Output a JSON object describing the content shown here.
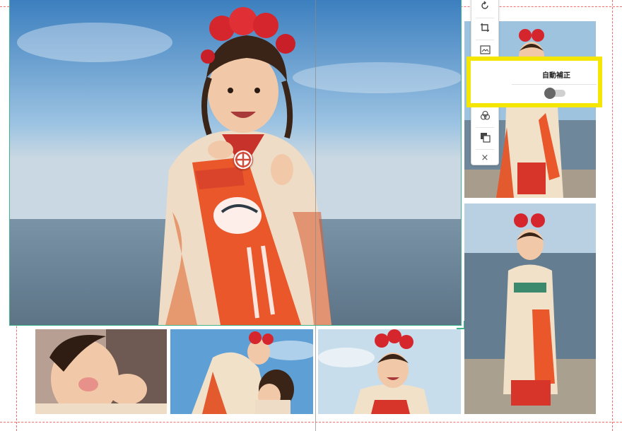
{
  "toolbar": {
    "tools": [
      {
        "name": "rotate-icon"
      },
      {
        "name": "crop-icon"
      },
      {
        "name": "replace-image-icon"
      },
      {
        "name": "magic-wand-icon"
      },
      {
        "name": "brightness-icon"
      },
      {
        "name": "color-filter-icon"
      },
      {
        "name": "layer-order-icon"
      },
      {
        "name": "close-icon",
        "glyph": "×"
      }
    ]
  },
  "auto_correct_panel": {
    "label": "自動補正",
    "toggle_state": "off"
  },
  "colors": {
    "guide": "#ef6f6f",
    "selection": "#3fb58a",
    "highlight": "#f4e600",
    "banner": "#e9572b"
  }
}
